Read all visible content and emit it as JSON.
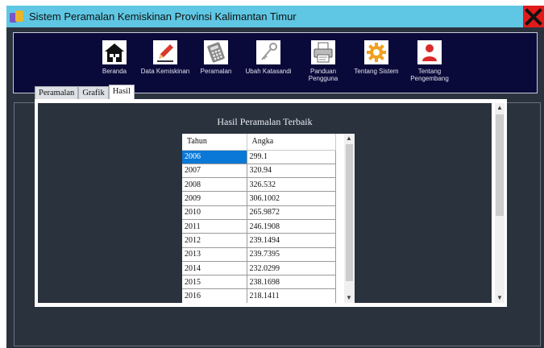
{
  "window": {
    "title": "Sistem Peramalan Kemiskinan Provinsi Kalimantan Timur"
  },
  "toolbar": {
    "items": [
      {
        "label": "Beranda",
        "icon": "house-icon"
      },
      {
        "label": "Data Kemiskinan",
        "icon": "pencil-icon"
      },
      {
        "label": "Peramalan",
        "icon": "calculator-icon"
      },
      {
        "label": "Ubah Katasandi",
        "icon": "key-icon"
      },
      {
        "label": "Panduan Pengguna",
        "icon": "printer-icon"
      },
      {
        "label": "Tentang Sistem",
        "icon": "gear-icon"
      },
      {
        "label": "Tentang Pengembang",
        "icon": "person-icon"
      }
    ]
  },
  "tabs": [
    {
      "label": "Peramalan"
    },
    {
      "label": "Grafik"
    },
    {
      "label": "Hasil"
    }
  ],
  "active_tab": "Hasil",
  "result": {
    "title": "Hasil Peramalan Terbaik",
    "columns": [
      "Tahun",
      "Angka"
    ],
    "rows": [
      [
        "2006",
        "299.1"
      ],
      [
        "2007",
        "320.94"
      ],
      [
        "2008",
        "326.532"
      ],
      [
        "2009",
        "306.1002"
      ],
      [
        "2010",
        "265.9872"
      ],
      [
        "2011",
        "246.1908"
      ],
      [
        "2012",
        "239.1494"
      ],
      [
        "2013",
        "239.7395"
      ],
      [
        "2014",
        "232.0299"
      ],
      [
        "2015",
        "238.1698"
      ],
      [
        "2016",
        "218.1411"
      ]
    ],
    "selected_row": 0
  },
  "colors": {
    "titlebar": "#5fc7e3",
    "toolbar_bg": "#0a0a3a",
    "window_bg": "#2a323e",
    "selection": "#0a78d7",
    "close": "#e21a1a"
  }
}
